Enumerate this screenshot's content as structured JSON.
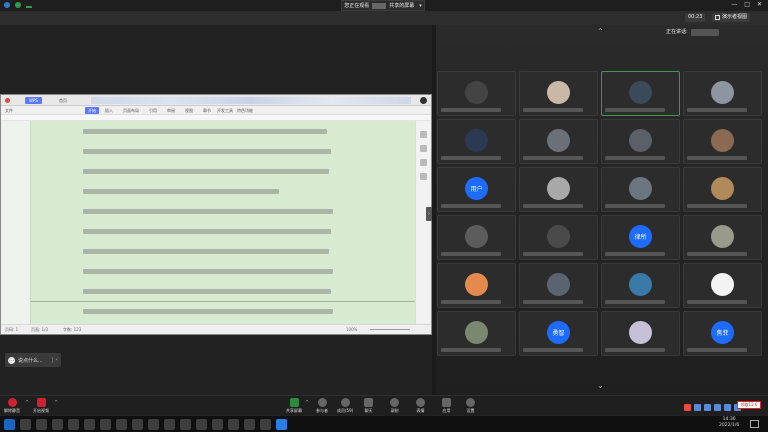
{
  "top": {
    "share_banner": "您正在观看",
    "share_banner_suffix": "共享的屏幕",
    "time": "00:23",
    "view_label": "演示者视图",
    "speaking_label": "正在讲话:"
  },
  "participants": {
    "avatar_names": [
      "用户",
      "律所",
      "勇智",
      "焦菲"
    ]
  },
  "document": {
    "tab_active": "WPS",
    "tab_secondary": "首页",
    "menus": [
      "文件",
      "开始",
      "插入",
      "页面布局",
      "引用",
      "审阅",
      "视图",
      "章节",
      "开发工具",
      "特色功能"
    ],
    "status_page": "页码: 1",
    "status_pages": "页面: 1/3",
    "status_words": "字数: 123",
    "status_zoom": "100%"
  },
  "chat": {
    "placeholder": "说点什么...",
    "collapse_icon": "chevron-left-icon"
  },
  "bottombar": {
    "mute_label": "解除静音",
    "video_label": "开启视频",
    "share_label": "共享屏幕",
    "participants_label": "参与者",
    "participants_count": "成员(59)",
    "chat_label": "聊天",
    "record_label": "录制",
    "reactions_label": "表情",
    "apps_label": "应用",
    "settings_label": "设置"
  },
  "taskbar": {
    "time": "14:36",
    "date": "2022/1/6",
    "badge": "领取12.6"
  }
}
